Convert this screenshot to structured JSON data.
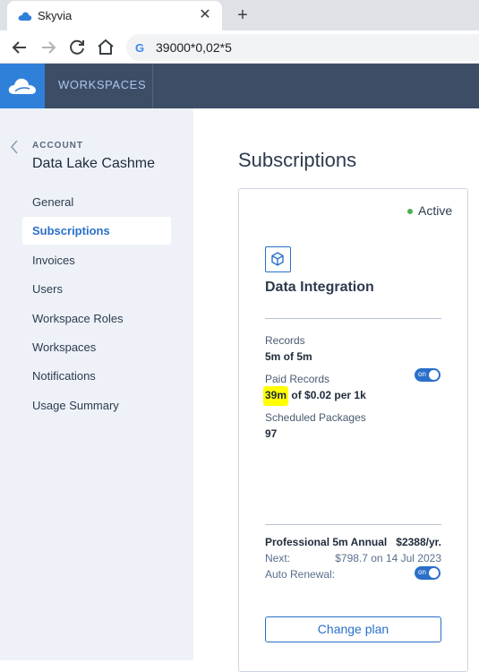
{
  "browser": {
    "tab_title": "Skyvia",
    "address_bar": "39000*0,02*5",
    "search_engine_glyph": "G"
  },
  "app": {
    "workspaces_label": "WORKSPACES",
    "brand_color": "#2f80d9",
    "header_color": "#3e4d66"
  },
  "sidebar": {
    "section_label": "ACCOUNT",
    "account_name": "Data Lake Cashme",
    "items": [
      {
        "label": "General"
      },
      {
        "label": "Subscriptions",
        "active": true
      },
      {
        "label": "Invoices"
      },
      {
        "label": "Users"
      },
      {
        "label": "Workspace Roles"
      },
      {
        "label": "Workspaces"
      },
      {
        "label": "Notifications"
      },
      {
        "label": "Usage Summary"
      }
    ]
  },
  "main": {
    "title": "Subscriptions",
    "card": {
      "status": "Active",
      "product_icon": "cube-icon",
      "product_name": "Data Integration",
      "records_label": "Records",
      "records_value": "5m of 5m",
      "paid_records_label": "Paid Records",
      "paid_records_highlight": "39m",
      "paid_records_rest": " of $0.02 per 1k",
      "paid_records_toggle": "on",
      "scheduled_label": "Scheduled Packages",
      "scheduled_value": "97",
      "plan_name": "Professional 5m Annual",
      "plan_price": "$2388/yr.",
      "next_label": "Next:",
      "next_value": "$798.7 on 14 Jul 2023",
      "auto_renewal_label": "Auto Renewal:",
      "auto_renewal_toggle": "on",
      "change_plan_label": "Change plan"
    }
  }
}
